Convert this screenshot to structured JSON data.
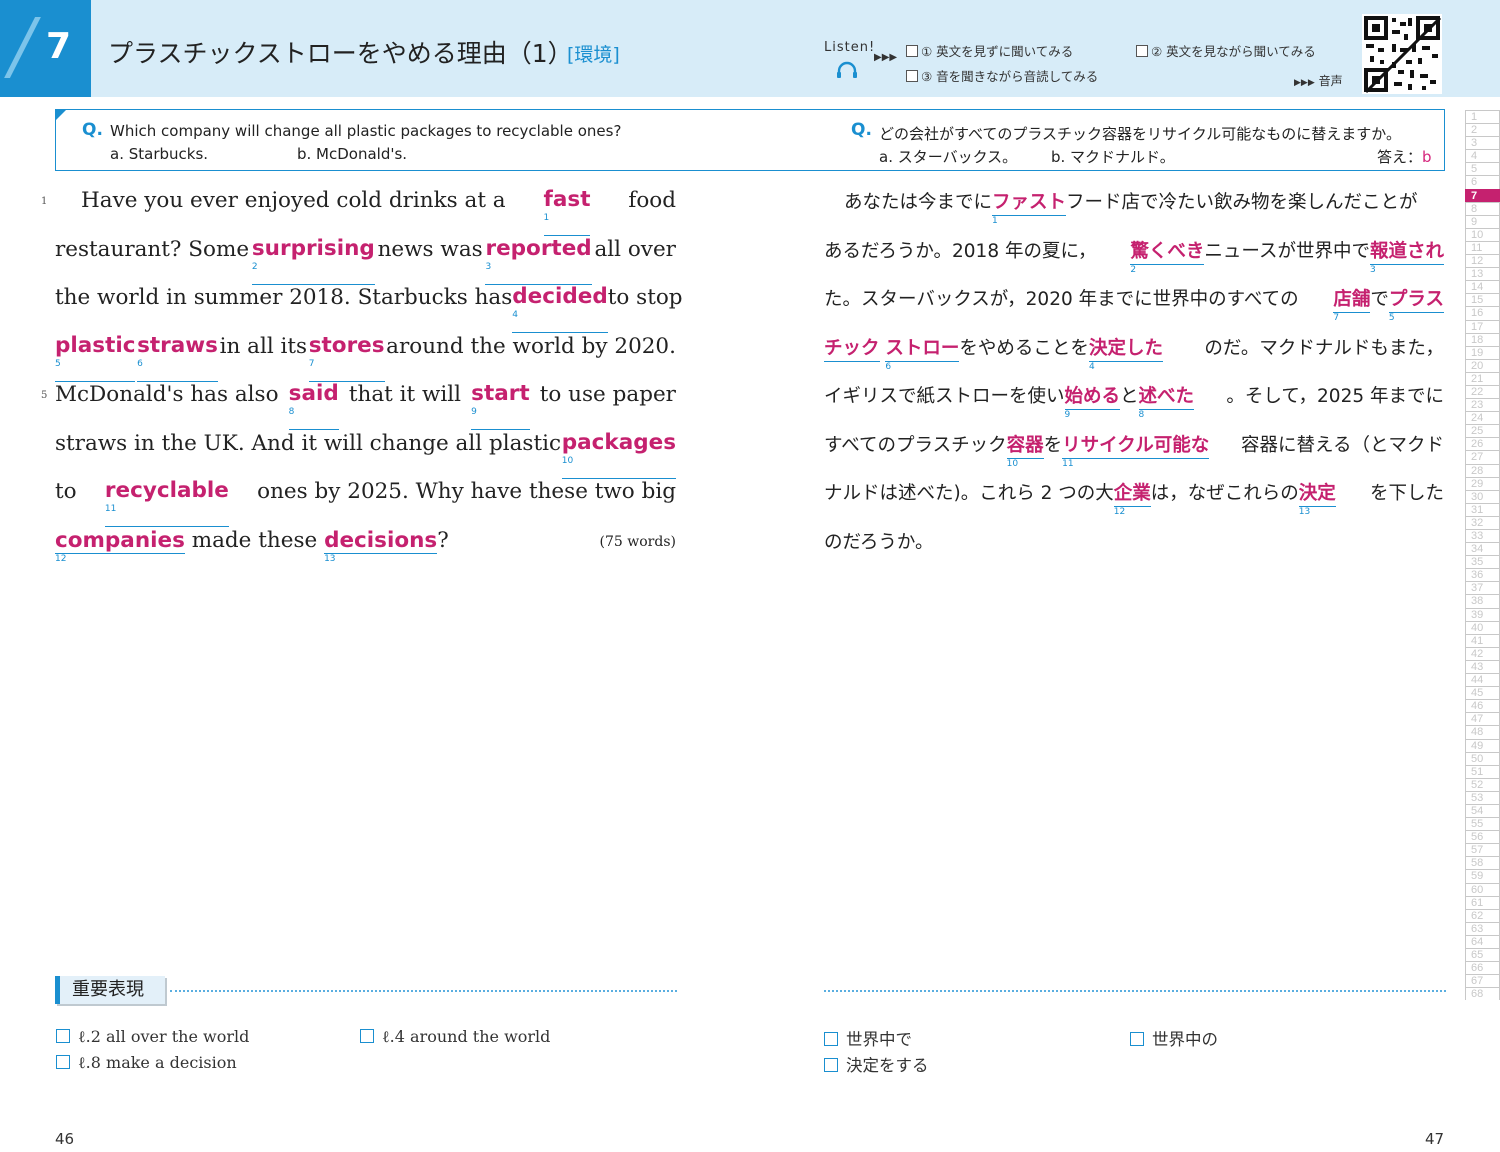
{
  "header": {
    "unit_number": "7",
    "title": "プラスチックストローをやめる理由（1）",
    "tag": "[環境]",
    "listen_label": "Listen!",
    "tasks": [
      "① 英文を見ずに聞いてみる",
      "② 英文を見ながら聞いてみる",
      "③ 音を聞きながら音読してみる"
    ],
    "audio_label": "音声"
  },
  "question": {
    "en_mark": "Q.",
    "en_question": "Which company will change all plastic packages to recyclable ones?",
    "en_option_a": "a. Starbucks.",
    "en_option_b": "b. McDonald's.",
    "jp_mark": "Q.",
    "jp_question": "どの会社がすべてのプラスチック容器をリサイクル可能なものに替えますか。",
    "jp_option_a": "a. スターバックス。",
    "jp_option_b": "b. マクドナルド。",
    "answer_label": "答え：",
    "answer_value": "b"
  },
  "passage": {
    "line_numbers": [
      "1",
      "5"
    ],
    "words_count": "(75 words)",
    "vocab": [
      {
        "word": "fast",
        "num": "1"
      },
      {
        "word": "surprising",
        "num": "2"
      },
      {
        "word": "reported",
        "num": "3"
      },
      {
        "word": "decided",
        "num": "4"
      },
      {
        "word": "plastic",
        "num": "5"
      },
      {
        "word": "straws",
        "num": "6"
      },
      {
        "word": "stores",
        "num": "7"
      },
      {
        "word": "said",
        "num": "8"
      },
      {
        "word": "start",
        "num": "9"
      },
      {
        "word": "packages",
        "num": "10"
      },
      {
        "word": "recyclable",
        "num": "11"
      },
      {
        "word": "companies",
        "num": "12"
      },
      {
        "word": "decisions",
        "num": "13"
      }
    ],
    "text": {
      "l1_a": "Have you ever enjoyed cold drinks at a",
      "l1_b": "food",
      "l2_a": "restaurant?  Some",
      "l2_b": "news was",
      "l2_c": "all over",
      "l3_a": "the world in summer 2018.  Starbucks has",
      "l3_b": "to stop",
      "l4_a": "in all its",
      "l4_b": "around the world by 2020.",
      "l5_a": "McDonald's has also",
      "l5_b": "that it will",
      "l5_c": "to use paper",
      "l6_a": "straws in the UK.  And it will change all plastic",
      "l7_a": "to",
      "l7_b": "ones by 2025.  Why have these two big",
      "l8_a": "made these",
      "l8_b": "?"
    }
  },
  "translation": {
    "vocab": [
      {
        "word": "ファスト",
        "num": "1"
      },
      {
        "word": "驚くべき",
        "num": "2"
      },
      {
        "word": "報道され",
        "num": "3"
      },
      {
        "word": "店舗",
        "num": "7"
      },
      {
        "word": "プラス",
        "num": "5"
      },
      {
        "word": "チック",
        "num": ""
      },
      {
        "word": "ストロー",
        "num": "6"
      },
      {
        "word": "決定した",
        "num": "4"
      },
      {
        "word": "始める",
        "num": "9"
      },
      {
        "word": "述べた",
        "num": "8"
      },
      {
        "word": "容器",
        "num": "10"
      },
      {
        "word": "リサイクル可能な",
        "num": "11"
      },
      {
        "word": "企業",
        "num": "12"
      },
      {
        "word": "決定",
        "num": "13"
      }
    ],
    "text": {
      "l1_a": "あなたは今までに",
      "l1_b": "フード店で冷たい飲み物を楽しんだことが",
      "l2_a": "あるだろうか。2018 年の夏に，",
      "l2_b": "ニュースが世界中で",
      "l3_a": "た。スターバックスが，2020 年までに世界中のすべての",
      "l3_b": "で",
      "l4_a": "をやめることを",
      "l4_b": "のだ。マクドナルドもまた，",
      "l5_a": "イギリスで紙ストローを使い",
      "l5_b": "と",
      "l5_c": "。そして，2025 年までに",
      "l6_a": "すべてのプラスチック",
      "l6_b": "を",
      "l6_c": "容器に替える（とマクド",
      "l7_a": "ナルドは述べた)。これら 2 つの大",
      "l7_b": "は，なぜこれらの",
      "l7_c": "を下した",
      "l8_a": "のだろうか。"
    }
  },
  "key_expressions": {
    "label": "重要表現",
    "en": [
      "ℓ.2 all over the world",
      "ℓ.4 around the world",
      "ℓ.8 make a decision"
    ],
    "jp": [
      "世界中で",
      "世界中の",
      "決定をする"
    ]
  },
  "page_numbers": {
    "left": "46",
    "right": "47"
  },
  "side_index": {
    "items": [
      "1",
      "2",
      "3",
      "4",
      "5",
      "6",
      "7",
      "8",
      "9",
      "10",
      "11",
      "12",
      "13",
      "14",
      "15",
      "16",
      "17",
      "18",
      "19",
      "20",
      "21",
      "22",
      "23",
      "24",
      "25",
      "26",
      "27",
      "28",
      "29",
      "30",
      "31",
      "32",
      "33",
      "34",
      "35",
      "36",
      "37",
      "38",
      "39",
      "40",
      "41",
      "42",
      "43",
      "44",
      "45",
      "46",
      "47",
      "48",
      "49",
      "50",
      "51",
      "52",
      "53",
      "54",
      "55",
      "56",
      "57",
      "58",
      "59",
      "60",
      "61",
      "62",
      "63",
      "64",
      "65",
      "66",
      "67",
      "68"
    ],
    "active": "7"
  },
  "colors": {
    "accent_blue": "#1a8fd0",
    "vocab_magenta": "#c5216f",
    "header_bg": "#d7ecf8"
  }
}
